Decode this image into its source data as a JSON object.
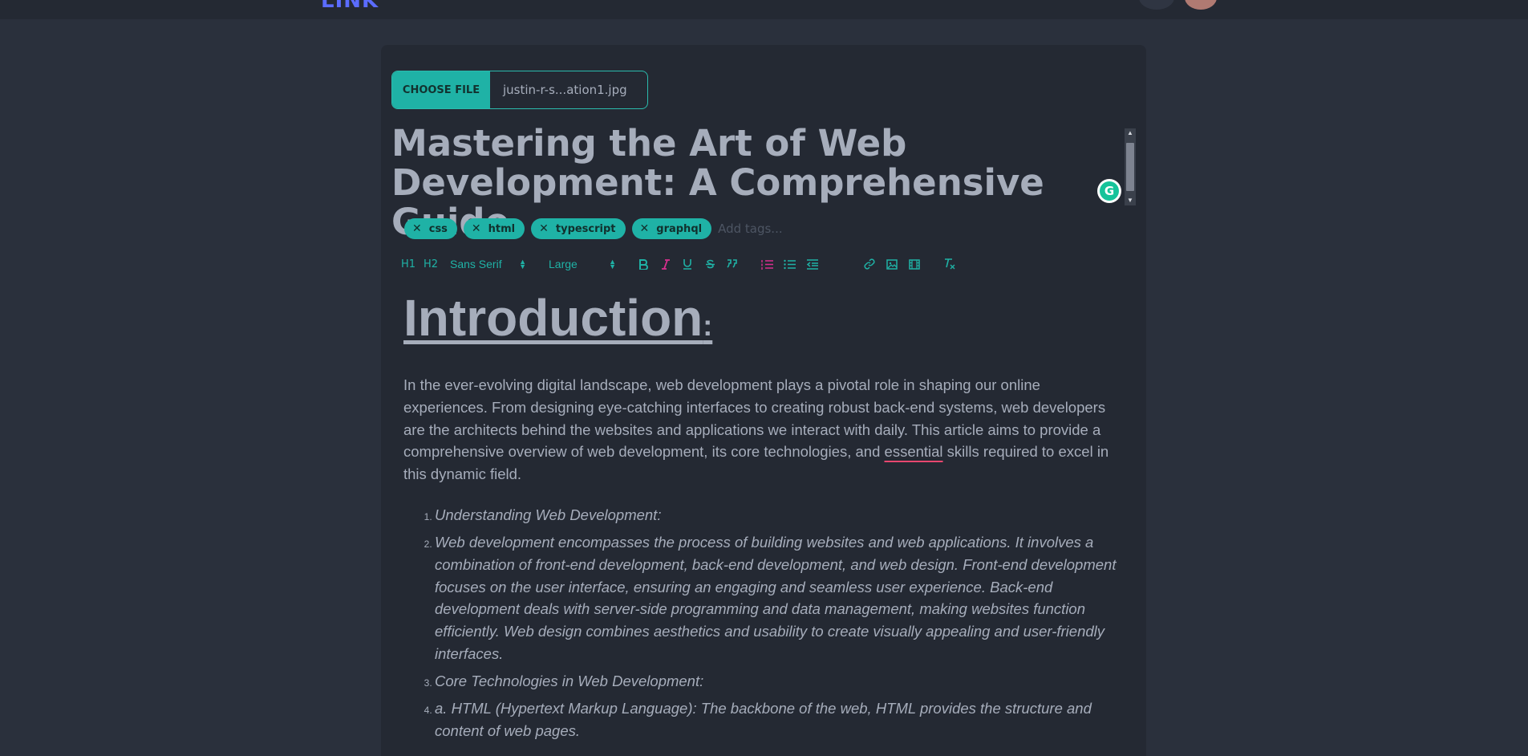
{
  "app": {
    "logo_text": "LINK"
  },
  "file_input": {
    "button_label": "CHOOSE FILE",
    "file_name": "justin-r-s...ation1.jpg"
  },
  "post": {
    "title": "Mastering the Art of Web Development: A Comprehensive Guide"
  },
  "tags": {
    "items": [
      "css",
      "html",
      "typescript",
      "graphql"
    ],
    "placeholder": "Add tags..."
  },
  "toolbar": {
    "h1": "H1",
    "h2": "H2",
    "font_family": "Sans Serif",
    "font_size": "Large"
  },
  "editor": {
    "heading": "Introduction",
    "heading_suffix": ":",
    "paragraph_before": "In the ever-evolving digital landscape, web development plays a pivotal role in shaping our online experiences. From designing eye-catching interfaces to creating robust back-end systems, web developers are the architects behind the websites and applications we interact with daily. This article aims to provide a comprehensive overview of web development, its core technologies, and ",
    "paragraph_flagged_word": "essential",
    "paragraph_after": " skills required to excel in this dynamic field.",
    "list": [
      "Understanding Web Development:",
      "Web development encompasses the process of building websites and web applications. It involves a combination of front-end development, back-end development, and web design. Front-end development focuses on the user interface, ensuring an engaging and seamless user experience. Back-end development deals with server-side programming and data management, making websites function efficiently. Web design combines aesthetics and usability to create visually appealing and user-friendly interfaces.",
      "Core Technologies in Web Development:",
      "a. HTML (Hypertext Markup Language): The backbone of the web, HTML provides the structure and content of web pages."
    ]
  },
  "colors": {
    "accent": "#1fb2a6",
    "background": "#2a303c",
    "surface": "#242933",
    "text": "#a6adbb",
    "pink": "#d92f8f"
  }
}
